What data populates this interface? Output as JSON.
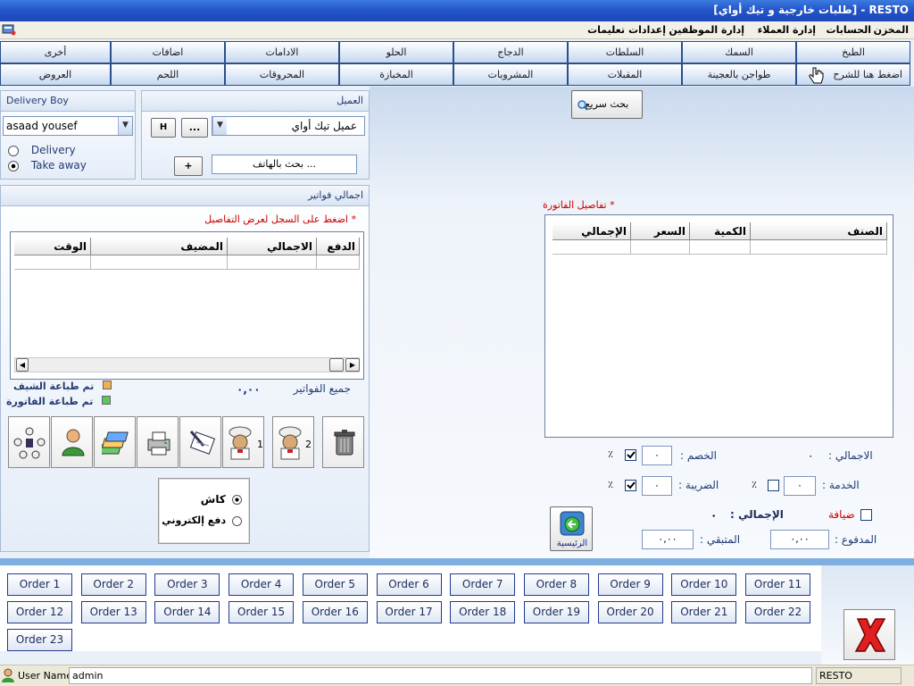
{
  "window": {
    "title": "RESTO - [طلبات خارجية و تيك أواي]"
  },
  "menu": {
    "items": [
      "المخزن",
      "الحسابات",
      "إدارة العملاء",
      "إدارة الموظفين",
      "إعدادات",
      "تعليمات"
    ]
  },
  "categories": {
    "row1": [
      "الطبخ",
      "السمك",
      "السلطات",
      "الدجاج",
      "الحلو",
      "الادامات",
      "اضافات",
      "أخرى"
    ],
    "row2": [
      "اضغط هنا للشرح",
      "طواجن بالعجينة",
      "المقبلات",
      "المشروبات",
      "المخبازة",
      "المحروقات",
      "اللحم",
      "العروض"
    ]
  },
  "quick_search": {
    "label": "بحث سريع"
  },
  "customer": {
    "header": "العميل",
    "selected": "عميل تيك أواي",
    "more_label": "...",
    "h_label": "H",
    "phone_search": "بحث بالهاتف ...",
    "add_label": "+"
  },
  "delivery_boy": {
    "header": "Delivery Boy",
    "selected": "asaad yousef",
    "options": [
      {
        "label": "Delivery",
        "checked": false
      },
      {
        "label": "Take away",
        "checked": true
      }
    ]
  },
  "invoices": {
    "header": "اجمالي فواتير",
    "hint": "اضغط على السجل لعرض التفاصيل",
    "hint_star": "*",
    "columns": [
      "الدفع",
      "الاجمالي",
      "المضيف",
      "الوقت"
    ],
    "total_label": "جميع الفواتير",
    "total_value": "٠,٠٠",
    "legend": [
      {
        "label": "تم طباعة الشيف",
        "color": "#f0b050"
      },
      {
        "label": "تم طباعة الفاتورة",
        "color": "#5cc85c"
      }
    ]
  },
  "toolbar": {
    "buttons": [
      {
        "icon": "trash-icon",
        "label": ""
      },
      {
        "icon": "chef-icon",
        "label": "2"
      },
      {
        "icon": "chef-icon",
        "label": "1"
      },
      {
        "icon": "edit-note-icon",
        "label": ""
      },
      {
        "icon": "printer-icon",
        "label": ""
      },
      {
        "icon": "stack-icon",
        "label": ""
      },
      {
        "icon": "user-icon",
        "label": ""
      },
      {
        "icon": "group-icon",
        "label": ""
      }
    ]
  },
  "payment": {
    "options": [
      {
        "label": "كاش",
        "checked": true
      },
      {
        "label": "دفع إلكتروني",
        "checked": false
      }
    ]
  },
  "invoice_details": {
    "title": "تفاصيل الفاتورة",
    "star": "*",
    "columns": [
      "الصنف",
      "الكمية",
      "السعر",
      "الإجمالي"
    ]
  },
  "totals": {
    "total_label": "الاجمالي :",
    "total_value": "٠",
    "discount_label": "الخصم :",
    "discount_value": "٠",
    "discount_checked": true,
    "percent": "٪",
    "service_label": "الخدمة :",
    "service_value": "٠",
    "service_checked": false,
    "tax_label": "الضريبة :",
    "tax_value": "٠",
    "tax_checked": true,
    "hospitality_label": "ضيافة",
    "grand_label": "الإجمالي :",
    "grand_value": "٠",
    "paid_label": "المدفوع :",
    "paid_value": "٠,٠٠",
    "remaining_label": "المتبقي :",
    "remaining_value": "٠,٠٠",
    "home_label": "الرئيسية"
  },
  "orders": [
    "Order 1",
    "Order 2",
    "Order 3",
    "Order 4",
    "Order 5",
    "Order 6",
    "Order 7",
    "Order 8",
    "Order 9",
    "Order 10",
    "Order 11",
    "Order 12",
    "Order 13",
    "Order 14",
    "Order 15",
    "Order 16",
    "Order 17",
    "Order 18",
    "Order 19",
    "Order 20",
    "Order 21",
    "Order 22",
    "Order 23"
  ],
  "status": {
    "user_label": "User Name:",
    "user_value": "admin",
    "app": "RESTO"
  },
  "colors": {
    "accent": "#2456c9",
    "order_border": "#233b8a",
    "close_red": "#e02020",
    "hint_red": "#cc0000"
  }
}
